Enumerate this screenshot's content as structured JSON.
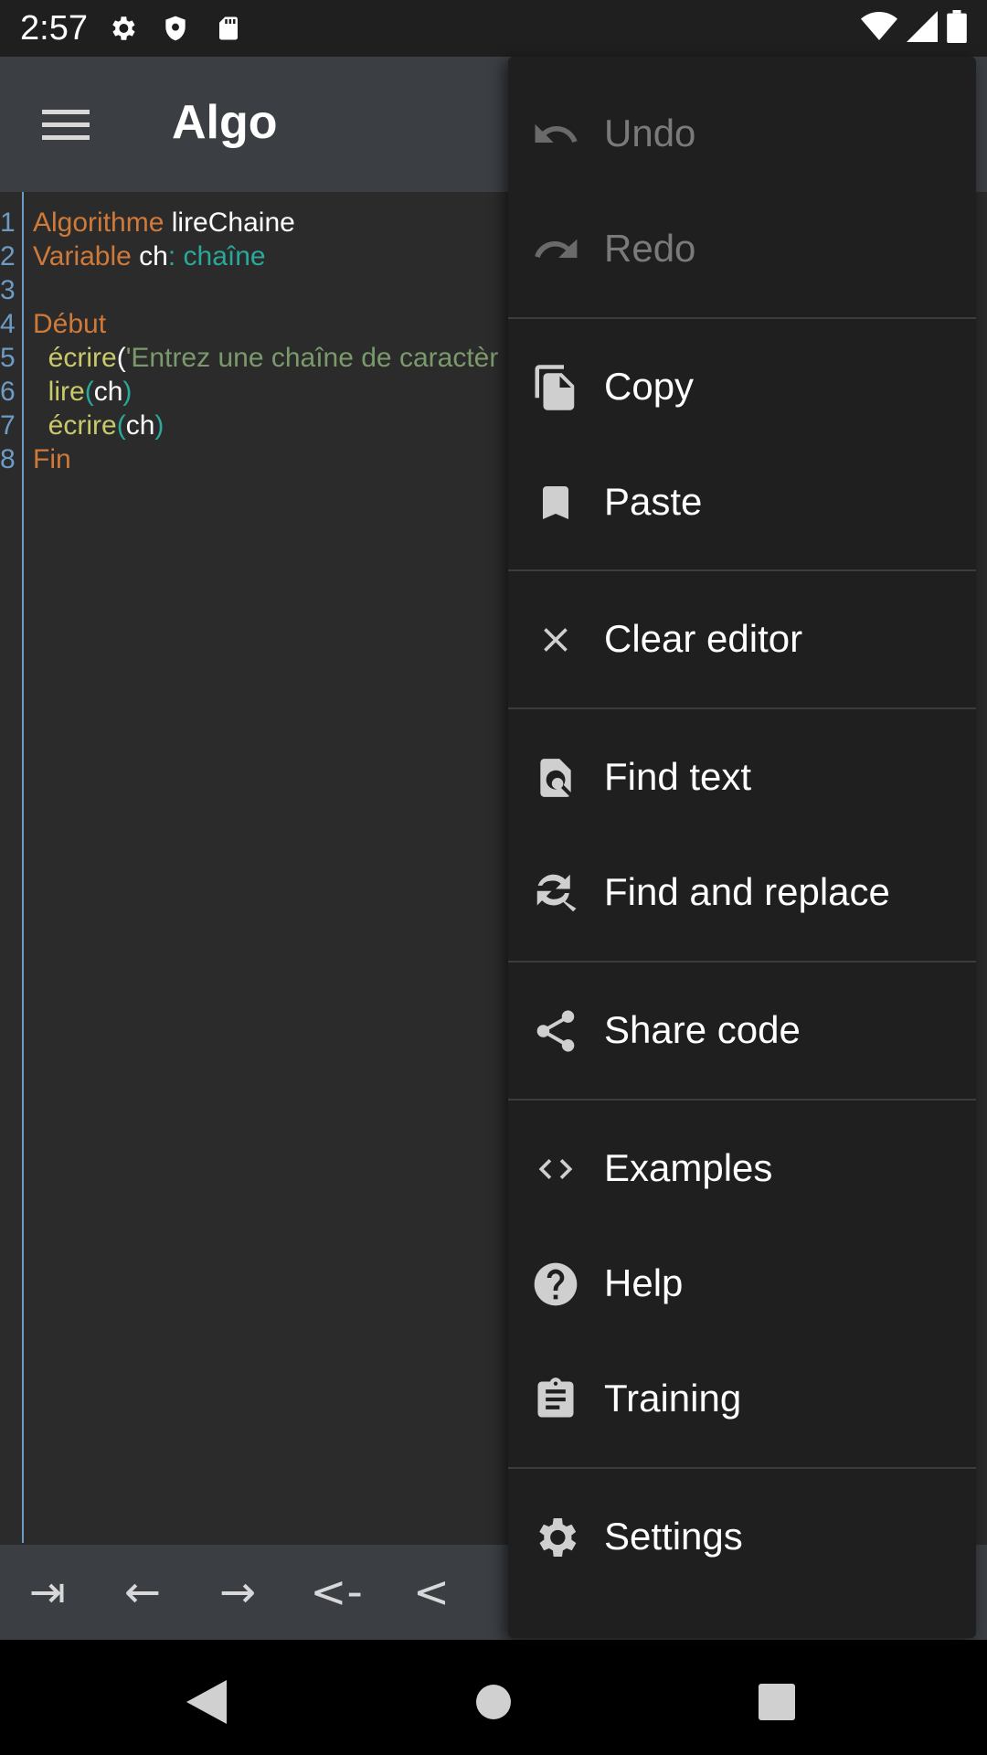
{
  "status_bar": {
    "time": "2:57",
    "left_icons": [
      "gear-icon",
      "shield-icon",
      "sd-card-icon"
    ],
    "right_icons": [
      "wifi-icon",
      "signal-icon",
      "battery-icon"
    ]
  },
  "app_bar": {
    "title": "Algo",
    "menu_icon": "hamburger-icon"
  },
  "editor": {
    "lines": [
      {
        "n": "1",
        "tokens": [
          {
            "t": "Algorithme",
            "c": "kw"
          },
          {
            "t": " lireChaine",
            "c": "pl"
          }
        ]
      },
      {
        "n": "2",
        "tokens": [
          {
            "t": "Variable",
            "c": "kw"
          },
          {
            "t": " ch",
            "c": "pl"
          },
          {
            "t": ": ",
            "c": "pc"
          },
          {
            "t": "chaîne",
            "c": "ty"
          }
        ]
      },
      {
        "n": "3",
        "tokens": []
      },
      {
        "n": "4",
        "tokens": [
          {
            "t": "Début",
            "c": "kw"
          }
        ]
      },
      {
        "n": "5",
        "tokens": [
          {
            "t": "  écrire",
            "c": "fn"
          },
          {
            "t": "(",
            "c": "pl"
          },
          {
            "t": "'Entrez une chaîne de caractèr",
            "c": "st"
          }
        ]
      },
      {
        "n": "6",
        "tokens": [
          {
            "t": "  lire",
            "c": "fn"
          },
          {
            "t": "(",
            "c": "pc"
          },
          {
            "t": "ch",
            "c": "pl"
          },
          {
            "t": ")",
            "c": "pc"
          }
        ]
      },
      {
        "n": "7",
        "tokens": [
          {
            "t": "  écrire",
            "c": "fn"
          },
          {
            "t": "(",
            "c": "pc"
          },
          {
            "t": "ch",
            "c": "pl"
          },
          {
            "t": ")",
            "c": "pc"
          }
        ]
      },
      {
        "n": "8",
        "tokens": [
          {
            "t": "Fin",
            "c": "kw"
          }
        ]
      }
    ]
  },
  "helper_bar": {
    "keys": [
      "⇥",
      "←",
      "→",
      "<-",
      "<"
    ]
  },
  "menu": {
    "items": [
      {
        "label": "Undo",
        "icon": "undo-icon",
        "disabled": true
      },
      {
        "label": "Redo",
        "icon": "redo-icon",
        "disabled": true
      },
      {
        "label": "Copy",
        "icon": "copy-icon",
        "disabled": false
      },
      {
        "label": "Paste",
        "icon": "paste-icon",
        "disabled": false
      },
      {
        "label": "Clear editor",
        "icon": "close-icon",
        "disabled": false
      },
      {
        "label": "Find text",
        "icon": "find-text-icon",
        "disabled": false
      },
      {
        "label": "Find and replace",
        "icon": "find-replace-icon",
        "disabled": false
      },
      {
        "label": "Share code",
        "icon": "share-icon",
        "disabled": false
      },
      {
        "label": "Examples",
        "icon": "code-icon",
        "disabled": false
      },
      {
        "label": "Help",
        "icon": "help-icon",
        "disabled": false
      },
      {
        "label": "Training",
        "icon": "clipboard-icon",
        "disabled": false
      },
      {
        "label": "Settings",
        "icon": "settings-icon",
        "disabled": false
      }
    ]
  },
  "colors": {
    "keyword": "#d07a3a",
    "function": "#c9c96a",
    "type": "#2aa89a",
    "string": "#7b9a6b",
    "line_number": "#6e9bc4",
    "app_bar": "#3b3f43",
    "menu_bg": "#1f1f1f"
  }
}
